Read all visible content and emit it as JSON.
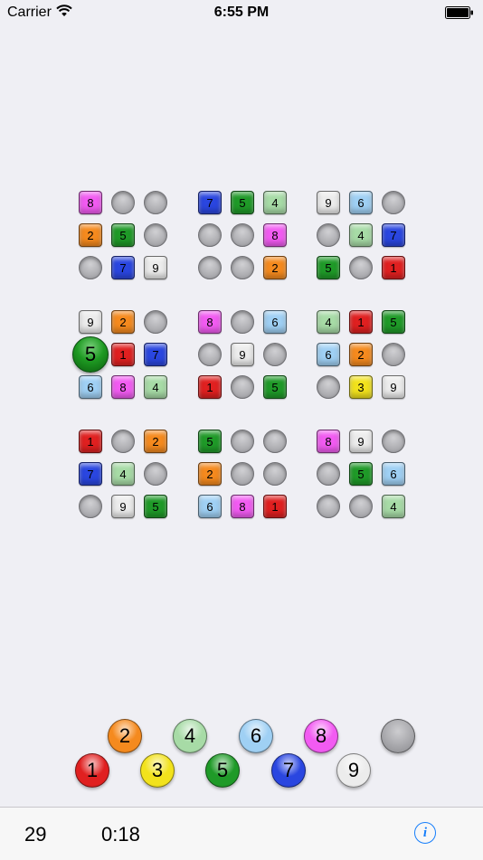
{
  "status_bar": {
    "carrier": "Carrier",
    "time": "6:55 PM",
    "icons": [
      "wifi-icon",
      "battery-icon"
    ]
  },
  "palette": {
    "1": "#e02020",
    "2": "#f58a1e",
    "3": "#f2e21c",
    "4": "#a7dba6",
    "5": "#1f9a28",
    "6": "#9fd0f4",
    "7": "#2a46e0",
    "8": "#f25bf2",
    "9": "#ececec"
  },
  "board": {
    "grid": [
      [
        8,
        0,
        0,
        7,
        5,
        4,
        9,
        6,
        0
      ],
      [
        2,
        5,
        0,
        0,
        0,
        8,
        0,
        4,
        7
      ],
      [
        0,
        7,
        9,
        0,
        0,
        2,
        5,
        0,
        1
      ],
      [
        9,
        2,
        0,
        8,
        0,
        6,
        4,
        1,
        5
      ],
      [
        5,
        1,
        7,
        0,
        9,
        0,
        6,
        2,
        0
      ],
      [
        6,
        8,
        4,
        1,
        0,
        5,
        0,
        3,
        9
      ],
      [
        1,
        0,
        2,
        5,
        0,
        0,
        8,
        9,
        0
      ],
      [
        7,
        4,
        0,
        2,
        0,
        0,
        0,
        5,
        6
      ],
      [
        0,
        9,
        5,
        6,
        8,
        1,
        0,
        0,
        4
      ]
    ],
    "selected_cell": {
      "row": 4,
      "col": 0,
      "value": "5"
    }
  },
  "number_picker": [
    "1",
    "2",
    "3",
    "4",
    "5",
    "6",
    "7",
    "8",
    "9",
    ""
  ],
  "toolbar": {
    "moves": "29",
    "timer": "0:18",
    "info_icon": "info-icon"
  }
}
